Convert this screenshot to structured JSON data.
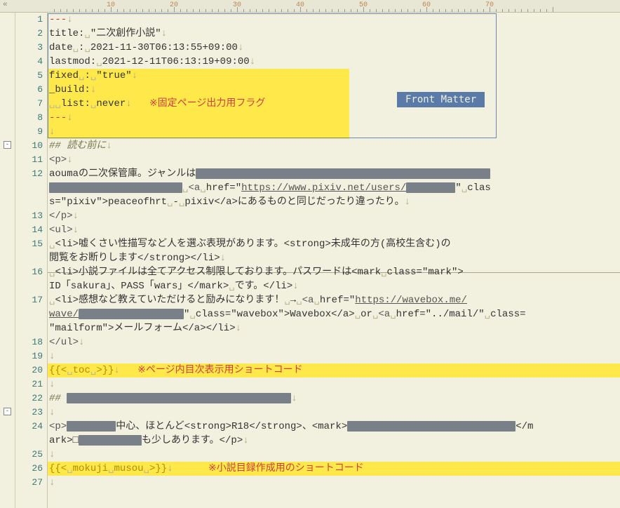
{
  "ruler_marks": [
    {
      "pos": 10,
      "label": "10"
    },
    {
      "pos": 20,
      "label": "20"
    },
    {
      "pos": 30,
      "label": "30"
    },
    {
      "pos": 40,
      "label": "40"
    },
    {
      "pos": 50,
      "label": "50"
    },
    {
      "pos": 60,
      "label": "60"
    },
    {
      "pos": 70,
      "label": "70"
    }
  ],
  "badge_label": "Front Matter",
  "annotations": {
    "fixed_flag": "※固定ページ出力用フラグ",
    "toc": "※ページ内目次表示用ショートコード",
    "mokuji": "※小説目録作成用のショートコード"
  },
  "lines": {
    "l1": "---",
    "l2_a": "title:",
    "l2_b": "\"二次創作小説\"",
    "l3_a": "date",
    "l3_b": ":",
    "l3_c": "2021-11-30T06:13:55+09:00",
    "l4_a": "lastmod:",
    "l4_b": "2021-12-11T06:13:19+09:00",
    "l5_a": "fixed",
    "l5_b": ":",
    "l5_c": "\"true\"",
    "l6": "_build:",
    "l7_a": "list:",
    "l7_b": "never",
    "l8": "---",
    "l10_a": "##",
    "l10_b": "読む前に",
    "l11": "<p>",
    "l12_a": "aoumaの二次保管庫。ジャンルは",
    "l12_b": "<a",
    "l12_c": "href=\"",
    "l12_d": "https://www.pixiv.net/users/",
    "l12_e": "\"",
    "l12_f": "clas",
    "l12_g": "s=\"pixiv\">peaceofhrt",
    "l12_h": "-",
    "l12_i": "pixiv</a>にあるものと同じだったり違ったり。",
    "l13": "</p>",
    "l14": "<ul>",
    "l15_a": "<li>嘘くさい性描写など人を選ぶ表現があります。<strong>未成年の方(高校生含む)の閲覧をお断りします</strong></li>",
    "l16_a": "<li>小説ファイルは全てアクセス制限しております。パスワードは<mark",
    "l16_b": "class=\"mark\">",
    "l16_c": "ID「sakura」、PASS「wars」</mark>",
    "l16_d": "です。</li>",
    "l17_a": "<li>感想など教えていただけると励みになります！",
    "l17_b": "→",
    "l17_c": "<a",
    "l17_d": "href=\"",
    "l17_e": "https://wavebox.me/",
    "l17_f": "wave/",
    "l17_g": "\"",
    "l17_h": "class=\"wavebox\">Wavebox</a>",
    "l17_i": "or",
    "l17_j": "<a",
    "l17_k": "href=\"../mail/\"",
    "l17_l": "class=",
    "l17_m": "\"mailform\">メールフォーム</a></li>",
    "l18": "</ul>",
    "l20_a": "{{<",
    "l20_b": "toc",
    "l20_c": ">}}",
    "l22_a": "##",
    "l24_a": "<p>",
    "l24_b": "中心、ほとんど<strong>R18</strong>、<mark>",
    "l24_c": "</m",
    "l24_d": "ark>",
    "l24_e": "も少しあります。</p>",
    "l26_a": "{{<",
    "l26_b": "mokuji",
    "l26_c": "musou",
    "l26_d": ">}}"
  },
  "gutter": [
    "1",
    "2",
    "3",
    "4",
    "5",
    "6",
    "7",
    "8",
    "9",
    "10",
    "11",
    "12",
    "",
    "13",
    "14",
    "15",
    "",
    "16",
    "",
    "17",
    "",
    "",
    "18",
    "19",
    "20",
    "21",
    "22",
    "23",
    "24",
    "",
    "25",
    "26",
    "27"
  ]
}
